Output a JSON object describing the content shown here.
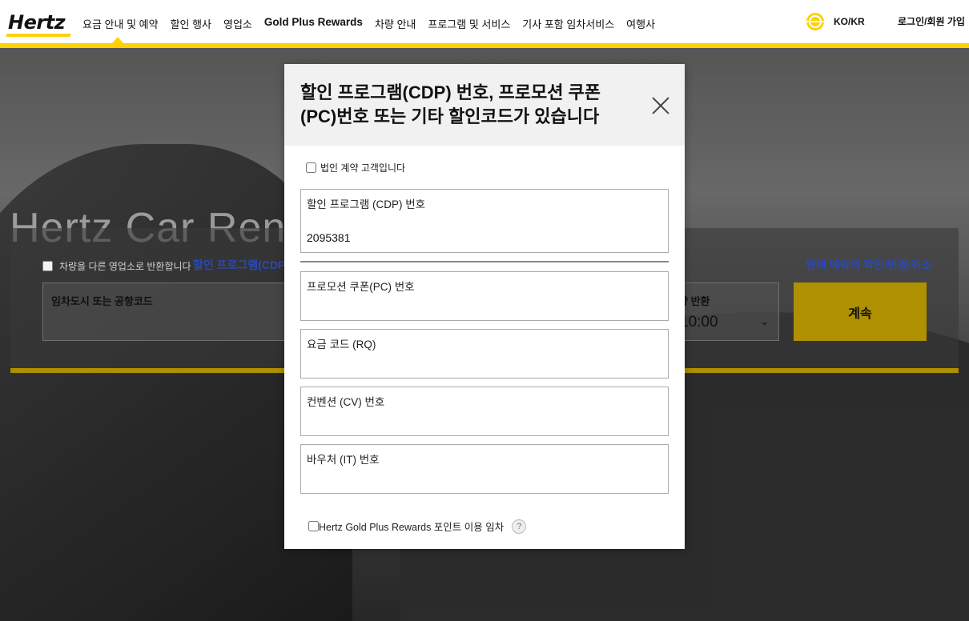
{
  "header": {
    "logo": "Hertz",
    "nav": [
      {
        "label": "요금 안내 및 예약"
      },
      {
        "label": "할인 행사"
      },
      {
        "label": "영업소"
      },
      {
        "label": "Gold Plus Rewards"
      },
      {
        "label": "차량 안내"
      },
      {
        "label": "프로그램 및 서비스"
      },
      {
        "label": "기사 포함 임차서비스"
      },
      {
        "label": "여행사"
      }
    ],
    "language": "KO/KR",
    "login": "로그인/회원 가입",
    "accent_color": "#ffd100"
  },
  "hero": {
    "title": "Hertz Car Rent"
  },
  "booking": {
    "return_different_label": "차량을 다른 영업소로 반환합니다",
    "discount_link": "할인 프로그램(CDP)",
    "manage_link": "현재 예약의 확인/변경/취소",
    "pickup_label": "임차도시 또는 공항코드",
    "return_label": "량 반환",
    "return_time": "10:00",
    "continue_label": "계속",
    "link_color": "#2d4dbf"
  },
  "modal": {
    "title": "할인 프로그램(CDP) 번호, 프로모션 쿠폰(PC)번호 또는 기타 할인코드가 있습니다",
    "corporate_label": "법인 계약 고객입니다",
    "cdp": {
      "label": "할인 프로그램 (CDP) 번호",
      "value": "2095381"
    },
    "pc": {
      "label": "프로모션 쿠폰(PC) 번호",
      "value": ""
    },
    "rq": {
      "label": "요금 코드 (RQ)",
      "value": ""
    },
    "cv": {
      "label": "컨벤션 (CV) 번호",
      "value": ""
    },
    "it": {
      "label": "바우처 (IT) 번호",
      "value": ""
    },
    "gold_points_label": "Hertz Gold Plus Rewards 포인트 이용 임차",
    "help_icon": "?"
  }
}
